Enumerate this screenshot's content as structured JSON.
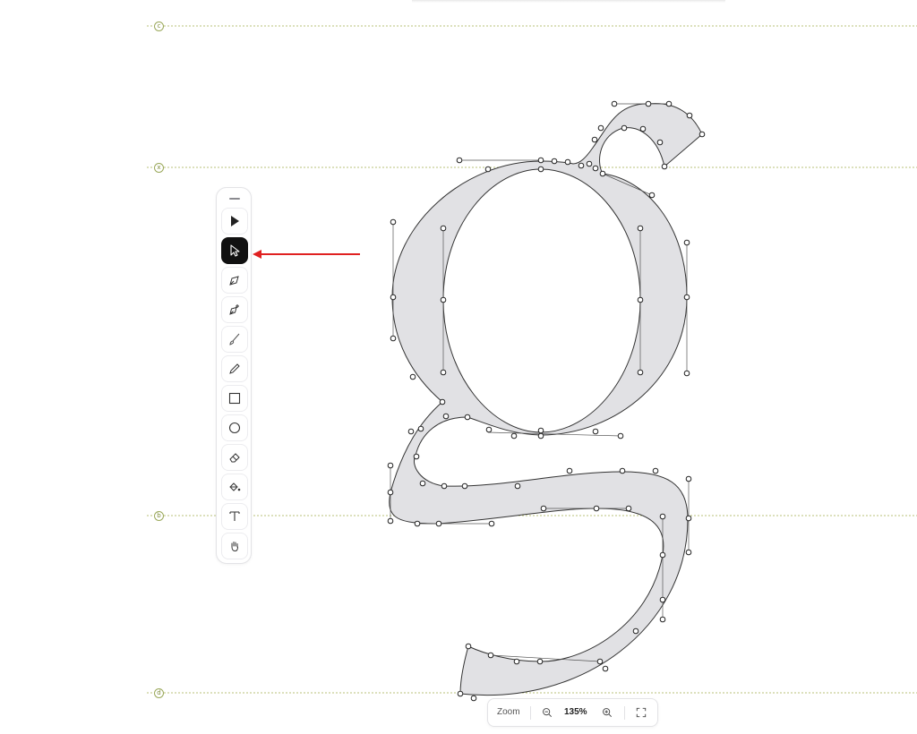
{
  "guides": [
    {
      "id": "ascender",
      "label": "c"
    },
    {
      "id": "xheight",
      "label": "x"
    },
    {
      "id": "baseline",
      "label": "b"
    },
    {
      "id": "descender",
      "label": "d"
    }
  ],
  "toolbar": {
    "tools": [
      {
        "name": "select-tool",
        "icon": "arrow-filled-icon"
      },
      {
        "name": "direct-select-tool",
        "icon": "cursor-icon",
        "active": true
      },
      {
        "name": "pen-tool",
        "icon": "pen-nib-icon"
      },
      {
        "name": "add-anchor-tool",
        "icon": "pen-plus-icon"
      },
      {
        "name": "brush-tool",
        "icon": "brush-icon"
      },
      {
        "name": "pencil-tool",
        "icon": "pencil-icon"
      },
      {
        "name": "rectangle-tool",
        "icon": "square-icon"
      },
      {
        "name": "ellipse-tool",
        "icon": "circle-icon"
      },
      {
        "name": "eraser-tool",
        "icon": "eraser-icon"
      },
      {
        "name": "fill-tool",
        "icon": "paint-bucket-icon"
      },
      {
        "name": "text-tool",
        "icon": "text-icon"
      },
      {
        "name": "hand-tool",
        "icon": "hand-icon"
      }
    ]
  },
  "zoom": {
    "label": "Zoom",
    "value": "135%"
  },
  "colors": {
    "glyph_fill": "#e1e1e4",
    "guide": "#b8c27a",
    "annotation": "#e02020"
  }
}
